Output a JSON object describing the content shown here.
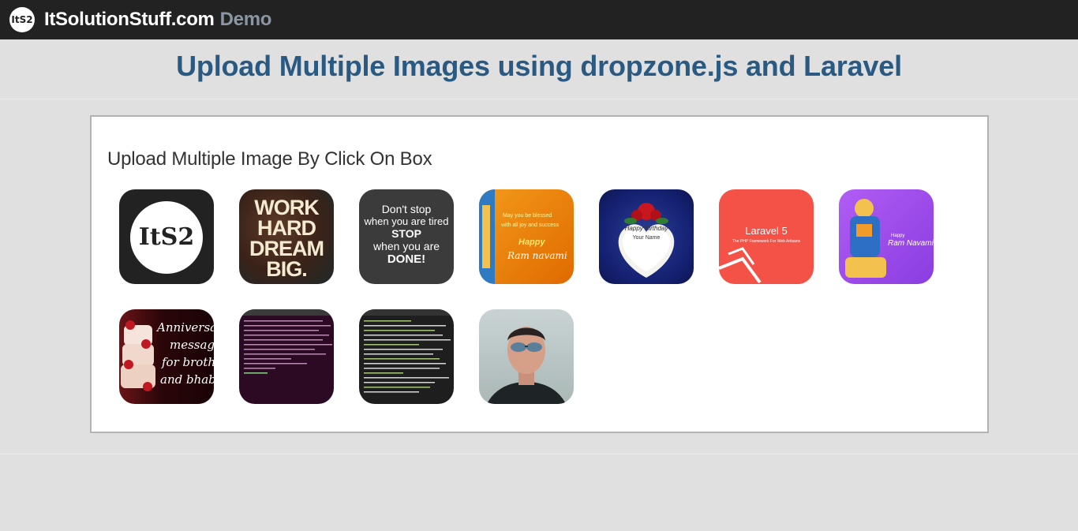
{
  "navbar": {
    "logo_text": "ItS2",
    "brand": "ItSolutionStuff.com",
    "demo": "Demo"
  },
  "page": {
    "title": "Upload Multiple Images using dropzone.js and Laravel"
  },
  "dropzone": {
    "message": "Upload Multiple Image By Click On Box"
  },
  "thumbnails": {
    "its2": {
      "logo_text": "ItS2"
    },
    "work_hard": {
      "line1": "WORK",
      "line2": "HARD",
      "line3": "DREAM",
      "line4": "BIG."
    },
    "dont_stop": {
      "line1": "Don't stop",
      "line2": "when you are tired",
      "line3": "STOP",
      "line4": "when you are",
      "line5": "DONE!"
    },
    "ram_navami_orange": {
      "line1": "May you be blessed",
      "line2": "with all joy and success",
      "line3": "Happy",
      "line4": "Ram navami"
    },
    "birthday_cake": {
      "line1": "Happy Birthday",
      "line2": "Your Name"
    },
    "laravel5": {
      "title": "Laravel 5",
      "subtitle": "The PHP Framework For Web Artisans"
    },
    "ram_navami_purple": {
      "line1": "Happy",
      "line2": "Ram Navami"
    },
    "anniversary": {
      "line1": "Anniversa",
      "line2": "message",
      "line3": "for brothe",
      "line4": "and bhabh"
    }
  },
  "colors": {
    "navbar_bg": "#222222",
    "page_bg": "#e0e0e0",
    "title": "#2a5a82",
    "laravel_red": "#f55247",
    "purple": "#a855f7",
    "orange": "#f07d00"
  }
}
